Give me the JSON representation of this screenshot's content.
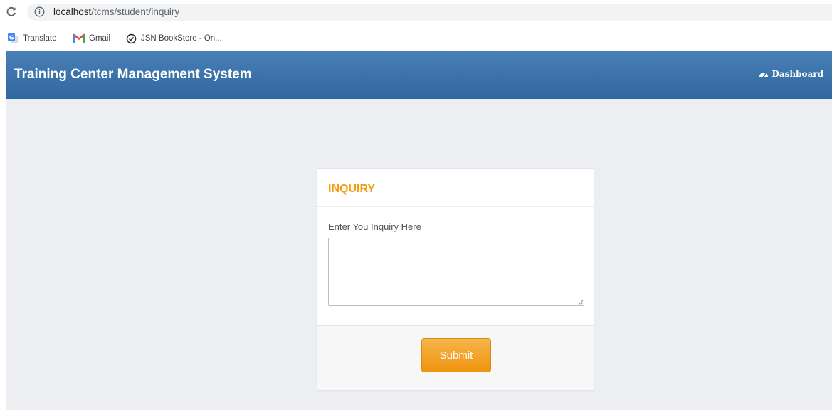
{
  "browser": {
    "url": {
      "host": "localhost",
      "path": "/tcms/student/inquiry"
    },
    "bookmarks": [
      {
        "label": "Translate",
        "icon": "google-translate-icon"
      },
      {
        "label": "Gmail",
        "icon": "gmail-icon"
      },
      {
        "label": "JSN BookStore - On...",
        "icon": "check-circle-icon"
      }
    ]
  },
  "navbar": {
    "brand": "Training Center Management System",
    "dashboard_label": "Dashboard",
    "dashboard_icon": "dashboard-gauge-icon",
    "background_color": "#3a72ab"
  },
  "inquiry_card": {
    "title": "INQUIRY",
    "title_color": "#f39c12",
    "field_label": "Enter You Inquiry Here",
    "field_value": "",
    "submit_label": "Submit",
    "submit_color": "#f39c12"
  }
}
